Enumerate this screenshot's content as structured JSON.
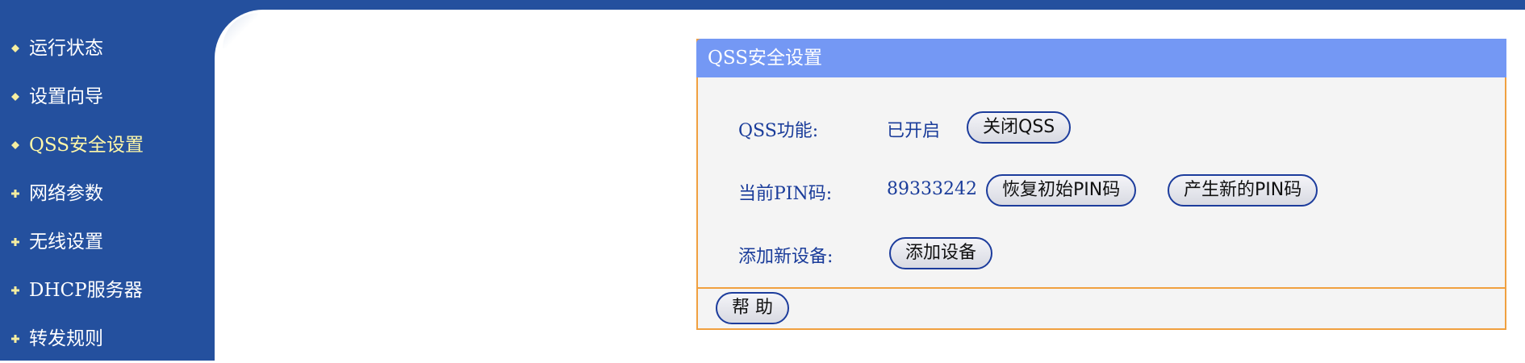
{
  "sidebar": {
    "items": [
      {
        "label": "运行状态",
        "icon": "diamond-bullet-icon",
        "active": false
      },
      {
        "label": "设置向导",
        "icon": "diamond-bullet-icon",
        "active": false
      },
      {
        "label": "QSS安全设置",
        "icon": "diamond-bullet-icon",
        "active": true
      },
      {
        "label": "网络参数",
        "icon": "plus-bullet-icon",
        "active": false
      },
      {
        "label": "无线设置",
        "icon": "plus-bullet-icon",
        "active": false
      },
      {
        "label": "DHCP服务器",
        "icon": "plus-bullet-icon",
        "active": false
      },
      {
        "label": "转发规则",
        "icon": "plus-bullet-icon",
        "active": false
      }
    ]
  },
  "panel": {
    "title": "QSS安全设置",
    "qss": {
      "label": "QSS功能:",
      "value": "已开启",
      "button": "关闭QSS"
    },
    "pin": {
      "label": "当前PIN码:",
      "value": "89333242",
      "restore_button": "恢复初始PIN码",
      "new_button": "产生新的PIN码"
    },
    "device": {
      "label": "添加新设备:",
      "button": "添加设备"
    },
    "help_button": "帮 助"
  },
  "colors": {
    "sidebar_bg": "#24509e",
    "active_text": "#fff8a8",
    "panel_header": "#7498f4",
    "panel_border": "#f0a040",
    "label_text": "#1a3c9a"
  }
}
